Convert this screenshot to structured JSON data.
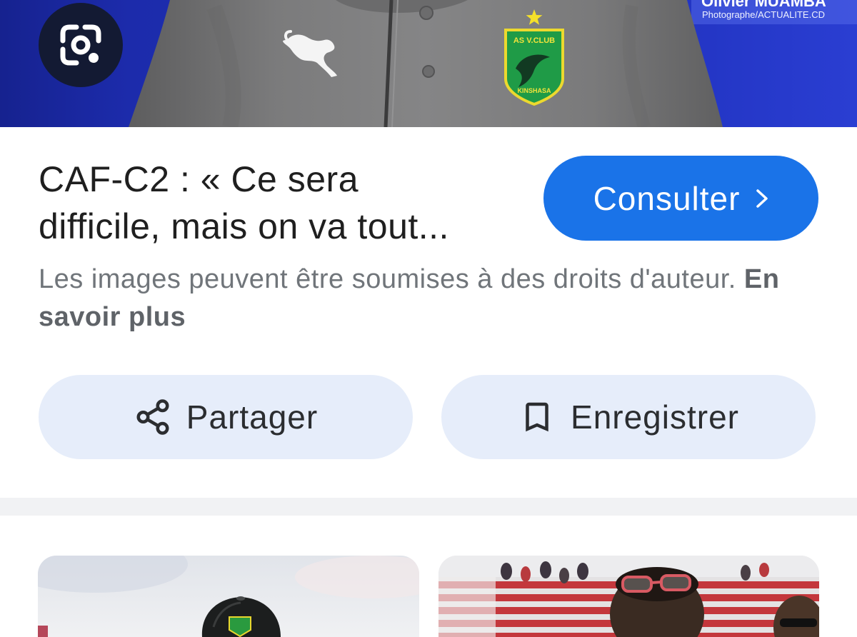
{
  "hero_image": {
    "photo_credit": {
      "name": "Olivier MUAMBA",
      "role": "Photographe/ACTUALITE.CD"
    },
    "badge": {
      "top_text": "AS V.CLUB",
      "bottom_text": "KINSHASA"
    },
    "lens_button": {
      "icon": "google-lens-icon"
    }
  },
  "result": {
    "title_lines": [
      "CAF-C2 : « Ce sera",
      "difficile, mais on va tout..."
    ],
    "visit_button": {
      "label": "Consulter",
      "icon": "chevron-right-icon"
    },
    "copyright": {
      "notice": "Les images peuvent être soumises à des droits d'auteur.",
      "learn_more": "En savoir plus"
    }
  },
  "actions": [
    {
      "label": "Partager",
      "icon": "share-icon"
    },
    {
      "label": "Enregistrer",
      "icon": "bookmark-icon"
    }
  ],
  "colors": {
    "accent": "#1a73e8",
    "action_button_bg": "#e6edfa",
    "title_text": "#1f1f1f",
    "secondary_text": "#70757a",
    "hero_background": "#1f2fb8",
    "shirt": "#7a7a7a",
    "badge_green": "#1f9b47",
    "badge_yellow": "#ecd92e"
  }
}
